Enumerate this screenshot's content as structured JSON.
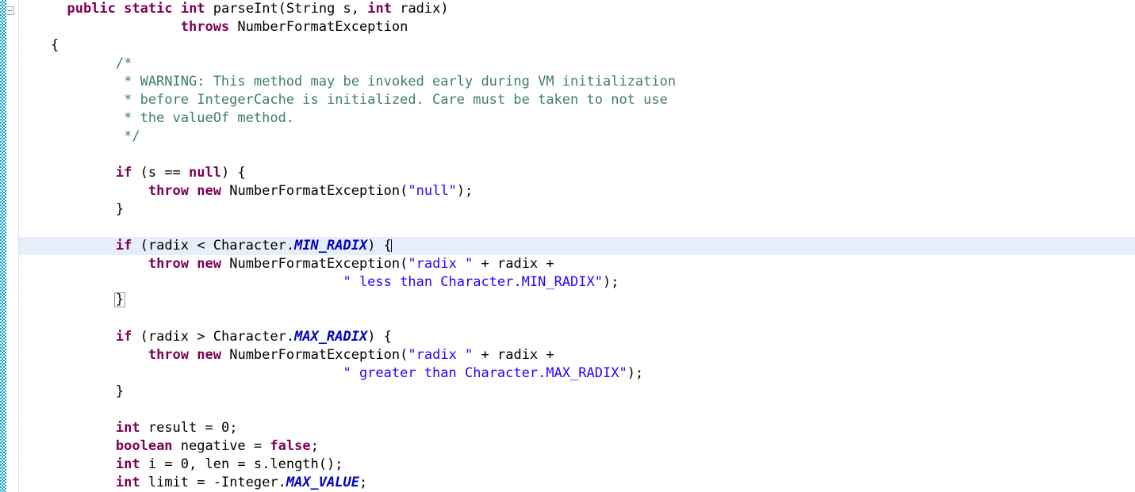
{
  "editor": {
    "kind": "java-source-editor",
    "language": "Java",
    "background_color": "#ffffff",
    "current_line_highlight_color": "#e7eefb",
    "brace_match_border_color": "#9a9a9a",
    "gutter": {
      "stripe_color": "#0a9ecb",
      "fold_icon_name": "collapse-fold-icon",
      "fold_icon_glyph": "−"
    },
    "colors": {
      "keyword": "#7f0055",
      "string": "#2a00ff",
      "comment": "#3f7f5f",
      "static_field": "#0000c0",
      "plain": "#000000"
    }
  },
  "code": {
    "lines": [
      {
        "id": "line-1",
        "current": false,
        "tokens": [
          {
            "t": "plain",
            "v": "  "
          },
          {
            "t": "kw",
            "v": "public"
          },
          {
            "t": "plain",
            "v": " "
          },
          {
            "t": "kw",
            "v": "static"
          },
          {
            "t": "plain",
            "v": " "
          },
          {
            "t": "kw",
            "v": "int"
          },
          {
            "t": "plain",
            "v": " parseInt(String s, "
          },
          {
            "t": "kw",
            "v": "int"
          },
          {
            "t": "plain",
            "v": " radix)"
          }
        ]
      },
      {
        "id": "line-2",
        "current": false,
        "tokens": [
          {
            "t": "plain",
            "v": "                "
          },
          {
            "t": "kw",
            "v": "throws"
          },
          {
            "t": "plain",
            "v": " NumberFormatException"
          }
        ]
      },
      {
        "id": "line-3",
        "current": false,
        "tokens": [
          {
            "t": "plain",
            "v": "{"
          }
        ]
      },
      {
        "id": "line-4",
        "current": false,
        "tokens": [
          {
            "t": "cmt",
            "v": "        /*"
          }
        ]
      },
      {
        "id": "line-5",
        "current": false,
        "tokens": [
          {
            "t": "cmt",
            "v": "         * WARNING: This method may be invoked early during VM initialization"
          }
        ]
      },
      {
        "id": "line-6",
        "current": false,
        "tokens": [
          {
            "t": "cmt",
            "v": "         * before IntegerCache is initialized. Care must be taken to not use"
          }
        ]
      },
      {
        "id": "line-7",
        "current": false,
        "tokens": [
          {
            "t": "cmt",
            "v": "         * the valueOf method."
          }
        ]
      },
      {
        "id": "line-8",
        "current": false,
        "tokens": [
          {
            "t": "cmt",
            "v": "         */"
          }
        ]
      },
      {
        "id": "line-9",
        "current": false,
        "tokens": [
          {
            "t": "plain",
            "v": ""
          }
        ]
      },
      {
        "id": "line-10",
        "current": false,
        "tokens": [
          {
            "t": "plain",
            "v": "        "
          },
          {
            "t": "kw",
            "v": "if"
          },
          {
            "t": "plain",
            "v": " (s == "
          },
          {
            "t": "kw",
            "v": "null"
          },
          {
            "t": "plain",
            "v": ") {"
          }
        ]
      },
      {
        "id": "line-11",
        "current": false,
        "tokens": [
          {
            "t": "plain",
            "v": "            "
          },
          {
            "t": "kw",
            "v": "throw"
          },
          {
            "t": "plain",
            "v": " "
          },
          {
            "t": "kw",
            "v": "new"
          },
          {
            "t": "plain",
            "v": " NumberFormatException("
          },
          {
            "t": "str",
            "v": "\"null\""
          },
          {
            "t": "plain",
            "v": ");"
          }
        ]
      },
      {
        "id": "line-12",
        "current": false,
        "tokens": [
          {
            "t": "plain",
            "v": "        }"
          }
        ]
      },
      {
        "id": "line-13",
        "current": false,
        "tokens": [
          {
            "t": "plain",
            "v": ""
          }
        ]
      },
      {
        "id": "line-14",
        "current": true,
        "tokens": [
          {
            "t": "plain",
            "v": "        "
          },
          {
            "t": "kw",
            "v": "if"
          },
          {
            "t": "plain",
            "v": " (radix < Character."
          },
          {
            "t": "sfield",
            "v": "MIN_RADIX"
          },
          {
            "t": "plain",
            "v": ") {"
          },
          {
            "t": "caret",
            "v": ""
          }
        ]
      },
      {
        "id": "line-15",
        "current": false,
        "tokens": [
          {
            "t": "plain",
            "v": "            "
          },
          {
            "t": "kw",
            "v": "throw"
          },
          {
            "t": "plain",
            "v": " "
          },
          {
            "t": "kw",
            "v": "new"
          },
          {
            "t": "plain",
            "v": " NumberFormatException("
          },
          {
            "t": "str",
            "v": "\"radix \""
          },
          {
            "t": "plain",
            "v": " + radix +"
          }
        ]
      },
      {
        "id": "line-16",
        "current": false,
        "tokens": [
          {
            "t": "plain",
            "v": "                                    "
          },
          {
            "t": "str",
            "v": "\" less than Character.MIN_RADIX\""
          },
          {
            "t": "plain",
            "v": ");"
          }
        ]
      },
      {
        "id": "line-17",
        "current": false,
        "tokens": [
          {
            "t": "plain",
            "v": "        "
          },
          {
            "t": "brace",
            "v": "}"
          }
        ]
      },
      {
        "id": "line-18",
        "current": false,
        "tokens": [
          {
            "t": "plain",
            "v": ""
          }
        ]
      },
      {
        "id": "line-19",
        "current": false,
        "tokens": [
          {
            "t": "plain",
            "v": "        "
          },
          {
            "t": "kw",
            "v": "if"
          },
          {
            "t": "plain",
            "v": " (radix > Character."
          },
          {
            "t": "sfield",
            "v": "MAX_RADIX"
          },
          {
            "t": "plain",
            "v": ") {"
          }
        ]
      },
      {
        "id": "line-20",
        "current": false,
        "tokens": [
          {
            "t": "plain",
            "v": "            "
          },
          {
            "t": "kw",
            "v": "throw"
          },
          {
            "t": "plain",
            "v": " "
          },
          {
            "t": "kw",
            "v": "new"
          },
          {
            "t": "plain",
            "v": " NumberFormatException("
          },
          {
            "t": "str",
            "v": "\"radix \""
          },
          {
            "t": "plain",
            "v": " + radix +"
          }
        ]
      },
      {
        "id": "line-21",
        "current": false,
        "tokens": [
          {
            "t": "plain",
            "v": "                                    "
          },
          {
            "t": "str",
            "v": "\" greater than Character.MAX_RADIX\""
          },
          {
            "t": "plain",
            "v": ");"
          }
        ]
      },
      {
        "id": "line-22",
        "current": false,
        "tokens": [
          {
            "t": "plain",
            "v": "        }"
          }
        ]
      },
      {
        "id": "line-23",
        "current": false,
        "tokens": [
          {
            "t": "plain",
            "v": ""
          }
        ]
      },
      {
        "id": "line-24",
        "current": false,
        "tokens": [
          {
            "t": "plain",
            "v": "        "
          },
          {
            "t": "kw",
            "v": "int"
          },
          {
            "t": "plain",
            "v": " result = 0;"
          }
        ]
      },
      {
        "id": "line-25",
        "current": false,
        "tokens": [
          {
            "t": "plain",
            "v": "        "
          },
          {
            "t": "kw",
            "v": "boolean"
          },
          {
            "t": "plain",
            "v": " negative = "
          },
          {
            "t": "kw",
            "v": "false"
          },
          {
            "t": "plain",
            "v": ";"
          }
        ]
      },
      {
        "id": "line-26",
        "current": false,
        "tokens": [
          {
            "t": "plain",
            "v": "        "
          },
          {
            "t": "kw",
            "v": "int"
          },
          {
            "t": "plain",
            "v": " i = 0, len = s.length();"
          }
        ]
      },
      {
        "id": "line-27",
        "current": false,
        "tokens": [
          {
            "t": "plain",
            "v": "        "
          },
          {
            "t": "kw",
            "v": "int"
          },
          {
            "t": "plain",
            "v": " limit = -Integer."
          },
          {
            "t": "sfield",
            "v": "MAX_VALUE"
          },
          {
            "t": "plain",
            "v": ";"
          }
        ]
      }
    ]
  }
}
